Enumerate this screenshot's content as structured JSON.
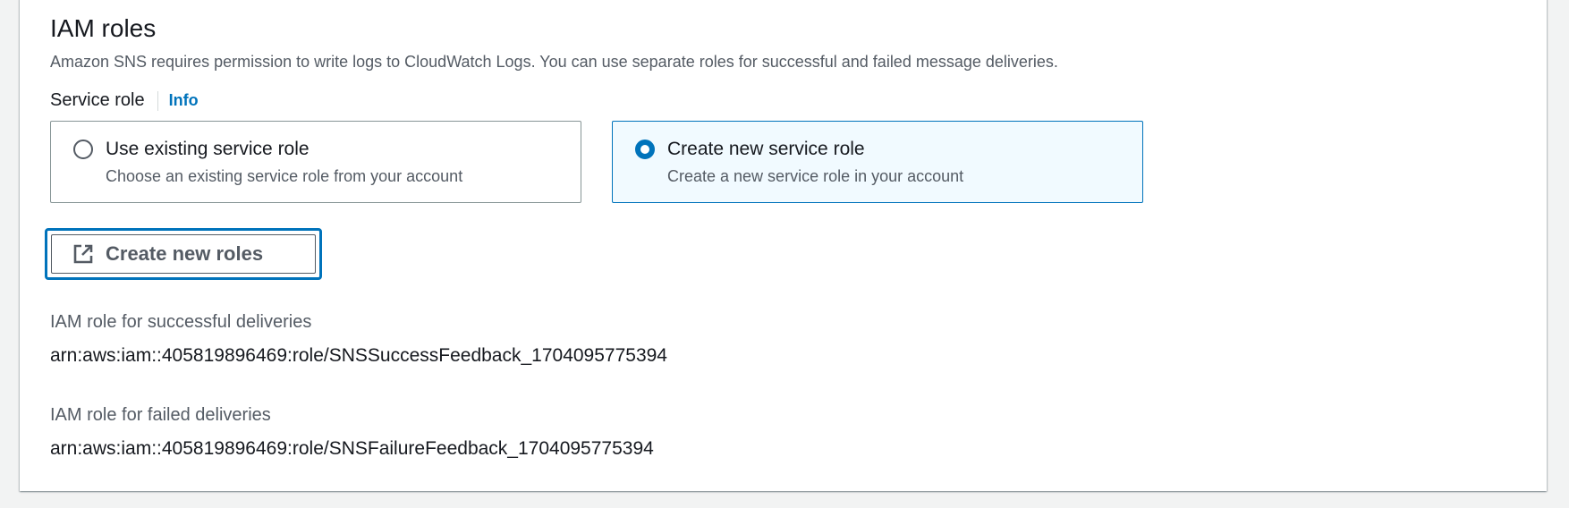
{
  "section": {
    "title": "IAM roles",
    "description": "Amazon SNS requires permission to write logs to CloudWatch Logs. You can use separate roles for successful and failed message deliveries."
  },
  "service_role": {
    "label": "Service role",
    "info_link": "Info",
    "options": [
      {
        "title": "Use existing service role",
        "description": "Choose an existing service role from your account",
        "selected": false
      },
      {
        "title": "Create new service role",
        "description": "Create a new service role in your account",
        "selected": true
      }
    ]
  },
  "create_button": {
    "label": "Create new roles",
    "icon": "external-link-icon"
  },
  "roles": {
    "success": {
      "label": "IAM role for successful deliveries",
      "value": "arn:aws:iam::405819896469:role/SNSSuccessFeedback_1704095775394"
    },
    "failure": {
      "label": "IAM role for failed deliveries",
      "value": "arn:aws:iam::405819896469:role/SNSFailureFeedback_1704095775394"
    }
  },
  "colors": {
    "accent": "#0073bb",
    "selected_tile_bg": "#f1faff",
    "text_primary": "#16191f",
    "text_secondary": "#545b64"
  }
}
